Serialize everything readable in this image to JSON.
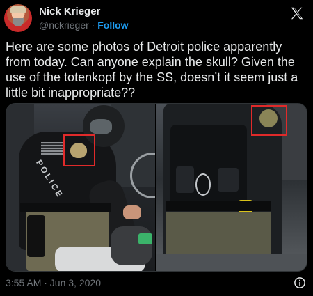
{
  "author": {
    "display_name": "Nick Krieger",
    "handle": "@nckrieger",
    "separator": "·",
    "follow_label": "Follow"
  },
  "brand_icon": "x-logo-icon",
  "tweet": {
    "text": "Here are some photos of Detroit police apparently from today. Can anyone explain the skull?  Given the use of the totenkopf by the SS, doesn’t it seem just a little bit inappropriate??"
  },
  "media": {
    "count": 2
  },
  "footer": {
    "timestamp": "3:55 AM · Jun 3, 2020",
    "info_icon": "info-icon"
  },
  "colors": {
    "background": "#000000",
    "text": "#e7e9ea",
    "muted": "#71767b",
    "accent": "#1d9bf0",
    "highlight_box": "#e02a2a"
  }
}
